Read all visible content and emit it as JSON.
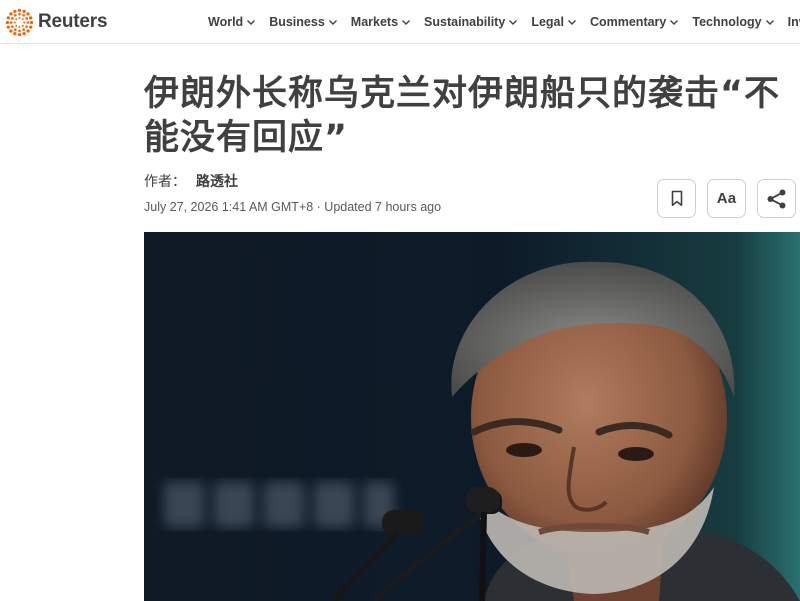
{
  "header": {
    "logo_text": "Reuters",
    "nav": [
      {
        "label": "World"
      },
      {
        "label": "Business"
      },
      {
        "label": "Markets"
      },
      {
        "label": "Sustainability"
      },
      {
        "label": "Legal"
      },
      {
        "label": "Commentary"
      },
      {
        "label": "Technology"
      },
      {
        "label": "Invest"
      }
    ]
  },
  "article": {
    "headline_line1": "伊朗外长称乌克兰对伊朗船只的袭击“不",
    "headline_line2": "能没有回应”",
    "byline_label": "作者：",
    "byline_name": "路透社",
    "dateline": "July 27, 2026 1:41 AM GMT+8 · Updated 7 hours ago"
  },
  "actions": {
    "font_label": "Aa"
  },
  "icons": {
    "logo": "reuters-dot-ring-icon",
    "nav_chevron": "chevron-down-icon",
    "bookmark": "bookmark-icon",
    "share": "share-icon"
  },
  "colors": {
    "brand_orange": "#fa6400",
    "text": "#404040",
    "photo_background": "#0e1a24"
  }
}
